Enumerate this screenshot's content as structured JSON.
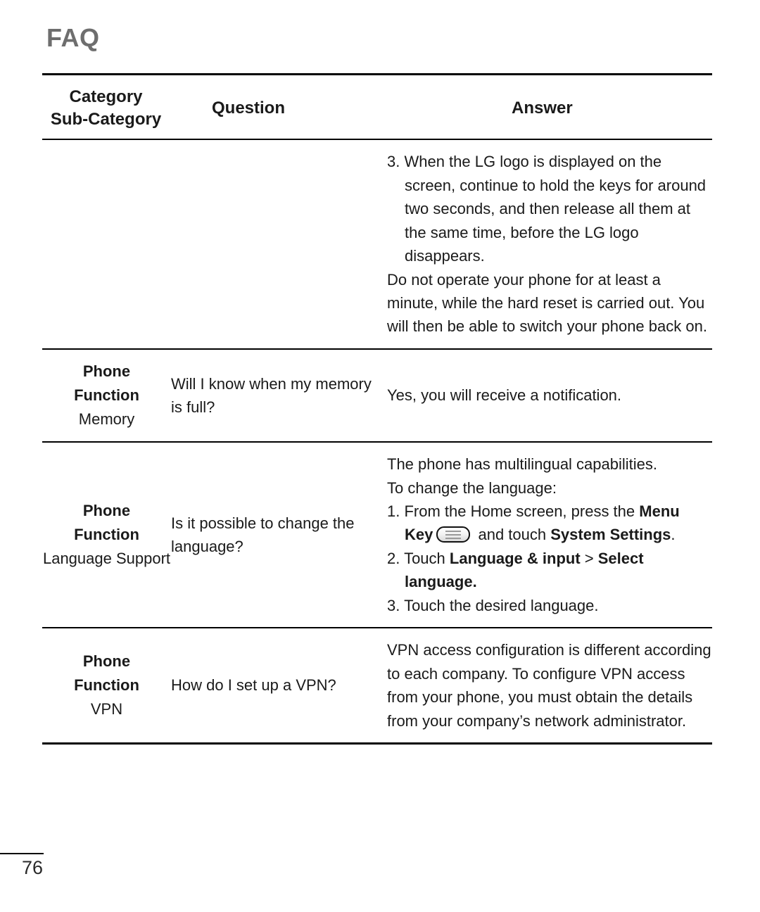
{
  "document": {
    "title": "FAQ",
    "page_number": "76"
  },
  "table": {
    "headers": {
      "category": "Category",
      "sub_category": "Sub-Category",
      "question": "Question",
      "answer": "Answer"
    },
    "rows": [
      {
        "category": "",
        "sub_category": "",
        "question": "",
        "answer_blocks": [
          {
            "kind": "numbered",
            "text": "3. When the LG logo is displayed on the screen, continue to hold the keys for around two seconds, and then release all them at the same time, before the LG logo disappears."
          },
          {
            "kind": "paragraph",
            "text": "Do not operate your phone for at least a minute, while the hard reset is carried out. You will then be able to switch your phone back on."
          }
        ]
      },
      {
        "category": "Phone Function",
        "sub_category": "Memory",
        "question": "Will I know when my memory is full?",
        "answer_blocks": [
          {
            "kind": "paragraph",
            "text": "Yes, you will receive a notification."
          }
        ]
      },
      {
        "category": "Phone Function",
        "sub_category": "Language Support",
        "question": "Is it possible to change the language?",
        "answer_blocks": [
          {
            "kind": "paragraph",
            "text": "The phone has multilingual capabilities."
          },
          {
            "kind": "paragraph",
            "text": "To change the language:"
          },
          {
            "kind": "numbered-rich-1",
            "text": "1. From the Home screen, press the Menu Key [menu-key-icon] and touch System Settings."
          },
          {
            "kind": "numbered-rich-2",
            "text": "2. Touch Language & input > Select language."
          },
          {
            "kind": "numbered",
            "text": "3. Touch the desired language."
          }
        ]
      },
      {
        "category": "Phone Function",
        "sub_category": "VPN",
        "question": "How do I set up a VPN?",
        "answer_blocks": [
          {
            "kind": "paragraph",
            "text": "VPN access configuration is different according to each company. To configure VPN access from your phone, you must obtain the details from your company’s network administrator."
          }
        ]
      }
    ]
  },
  "rich_text": {
    "lang_step1_pre": "1. From the Home screen, press the ",
    "lang_step1_menu": "Menu Key",
    "lang_step1_mid": " and touch ",
    "lang_step1_settings": "System Settings",
    "lang_step1_end": ".",
    "lang_step2_pre": "2. Touch ",
    "lang_step2_langinput": "Language & input",
    "lang_step2_gt": " > ",
    "lang_step2_select": "Select language.",
    "lang_step3": "3. Touch the desired language."
  },
  "icons": {
    "menu_key": "menu-key-icon"
  },
  "colors": {
    "title": "#6e6e6e",
    "text": "#1a1a1a",
    "rule": "#000000",
    "key_border": "#111111",
    "key_lines": "#9a9a9a"
  }
}
